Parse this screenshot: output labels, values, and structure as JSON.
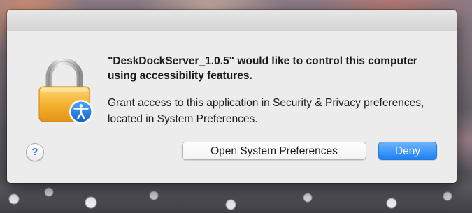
{
  "dialog": {
    "message": "\"DeskDockServer_1.0.5\" would like to control this computer using accessibility features.",
    "informative": "Grant access to this application in Security & Privacy preferences, located in System Preferences.",
    "help_label": "?",
    "open_prefs_label": "Open System Preferences",
    "deny_label": "Deny",
    "icons": {
      "main": "lock-icon",
      "badge": "accessibility-icon"
    }
  },
  "colors": {
    "dialog_bg": "#ececec",
    "primary_button": "#1b82f5",
    "lock_gold": "#f2b23a",
    "badge_blue": "#1f7ad8"
  }
}
